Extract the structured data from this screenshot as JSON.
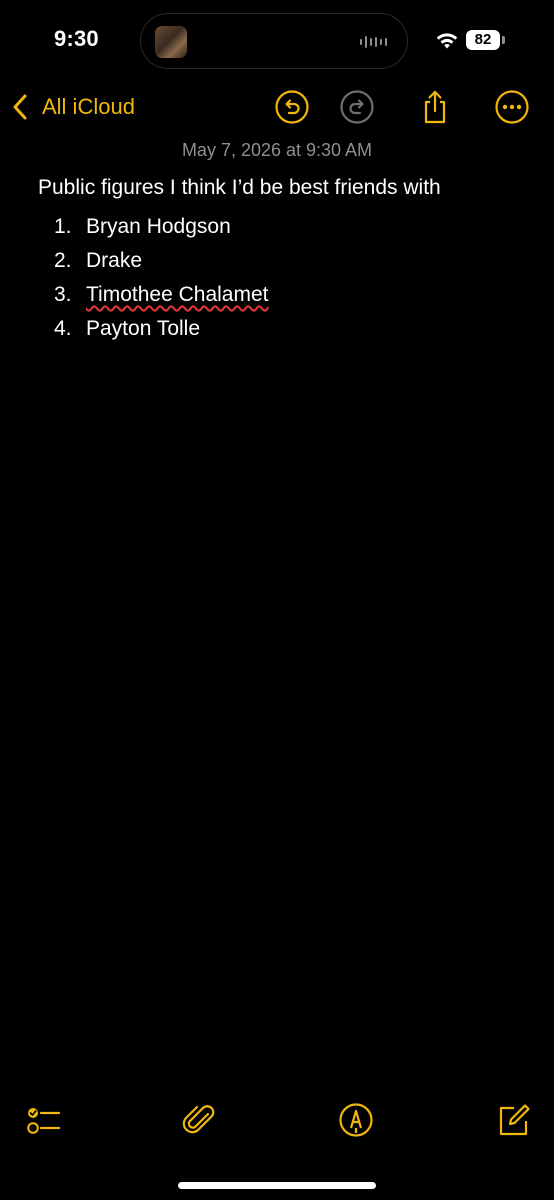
{
  "status_bar": {
    "time": "9:30",
    "battery": "82"
  },
  "nav": {
    "back_label": "All iCloud"
  },
  "note": {
    "date": "May 7, 2026 at 9:30 AM",
    "title": "Public figures I think I’d be best friends with",
    "items": [
      {
        "number": "1.",
        "text": "Bryan Hodgson"
      },
      {
        "number": "2.",
        "text": "Drake"
      },
      {
        "number": "3.",
        "text": "Timothee Chalamet"
      },
      {
        "number": "4.",
        "text": "Payton Tolle"
      }
    ]
  },
  "icons": {
    "back": "chevron-left-icon",
    "undo": "undo-icon",
    "redo": "redo-icon",
    "share": "share-icon",
    "more": "more-icon",
    "checklist": "checklist-icon",
    "attach": "paperclip-icon",
    "markup": "markup-pen-icon",
    "compose": "compose-icon"
  },
  "colors": {
    "accent": "#f2b60c",
    "background": "#000000",
    "date_text": "#8e8e93",
    "disabled": "#6e6e73",
    "spellcheck": "#e5383b"
  }
}
